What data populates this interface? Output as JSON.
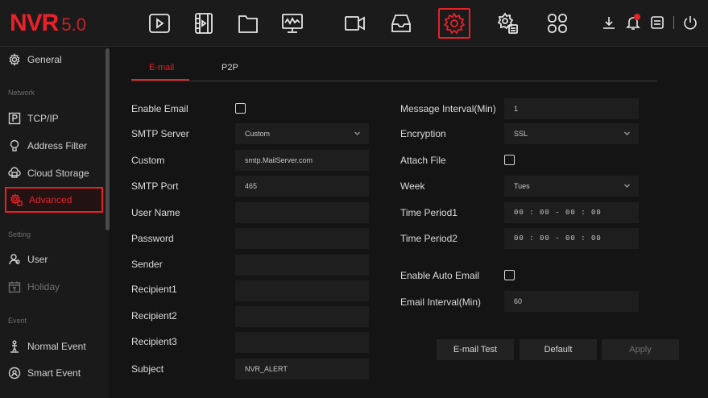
{
  "header": {
    "brand": "NVR",
    "version": "5.0",
    "nav_icons": [
      "playback-icon",
      "video-clip-icon",
      "folder-icon",
      "monitor-icon",
      "camera-icon",
      "storage-icon",
      "settings-icon",
      "system-icon",
      "grid-icon"
    ],
    "active_nav": "settings-icon",
    "right_icons": [
      "download-icon",
      "alarm-icon",
      "record-icon",
      "power-icon"
    ],
    "accent": "#e8212a"
  },
  "sidebar": {
    "items": [
      {
        "label": "General",
        "icon": "gear-icon"
      },
      {
        "group": "Network"
      },
      {
        "label": "TCP/IP",
        "icon": "p-box-icon"
      },
      {
        "label": "Address Filter",
        "icon": "filter-icon"
      },
      {
        "label": "Cloud Storage",
        "icon": "cloud-icon"
      },
      {
        "label": "Advanced",
        "icon": "advanced-gear-icon"
      },
      {
        "group": "Setting"
      },
      {
        "label": "User",
        "icon": "user-icon"
      },
      {
        "label": "Holiday",
        "icon": "calendar-icon"
      },
      {
        "group": "Event"
      },
      {
        "label": "Normal Event",
        "icon": "person-icon"
      },
      {
        "label": "Smart Event",
        "icon": "smart-icon"
      }
    ]
  },
  "tabs": [
    {
      "label": "E-mail"
    },
    {
      "label": "P2P"
    }
  ],
  "form_left": {
    "enable_email": "Enable Email",
    "smtp_server": "SMTP Server",
    "smtp_server_value": "Custom",
    "custom": "Custom",
    "custom_value": "smtp.MailServer.com",
    "smtp_port": "SMTP Port",
    "smtp_port_value": "465",
    "user_name": "User Name",
    "password": "Password",
    "sender": "Sender",
    "recipient1": "Recipient1",
    "recipient2": "Recipient2",
    "recipient3": "Recipient3",
    "subject": "Subject",
    "subject_value": "NVR_ALERT"
  },
  "form_right": {
    "message_interval": "Message Interval(Min)",
    "message_interval_value": "1",
    "encryption": "Encryption",
    "encryption_value": "SSL",
    "attach_file": "Attach File",
    "week": "Week",
    "week_value": "Tues",
    "time_period1": "Time Period1",
    "time_period1_value": "00 : 00 - 00 : 00",
    "time_period2": "Time Period2",
    "time_period2_value": "00 : 00 - 00 : 00",
    "enable_auto_email": "Enable Auto Email",
    "email_interval": "Email Interval(Min)",
    "email_interval_value": "60"
  },
  "buttons": {
    "email_test": "E-mail Test",
    "default": "Default",
    "apply": "Apply"
  }
}
